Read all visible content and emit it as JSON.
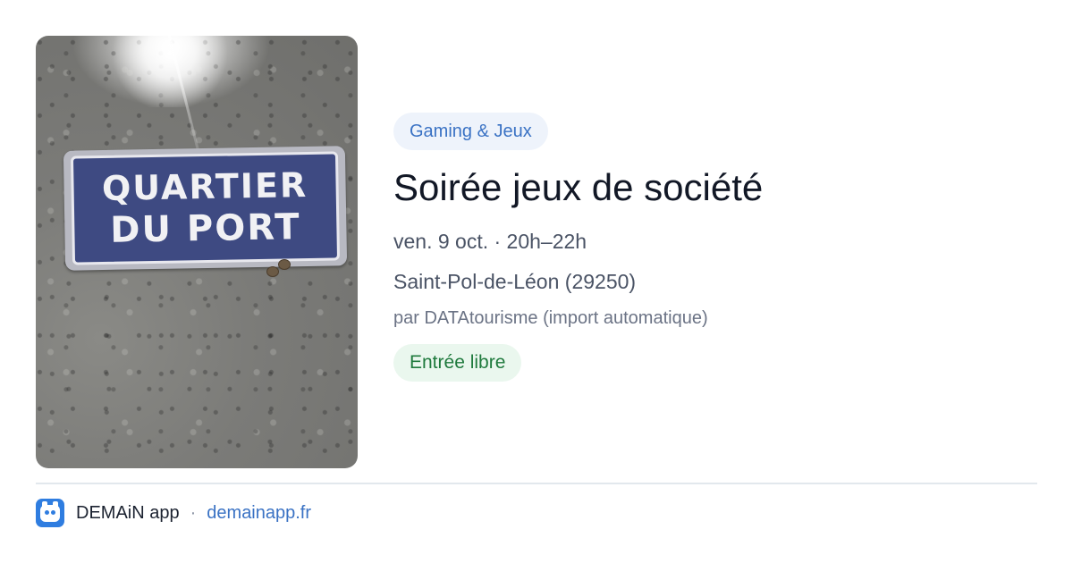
{
  "event": {
    "image": {
      "sign_line1": "QUARTIER",
      "sign_line2": "DU PORT"
    },
    "category": "Gaming & Jeux",
    "title": "Soirée jeux de société",
    "datetime": "ven. 9 oct. · 20h–22h",
    "location": "Saint-Pol-de-Léon (29250)",
    "organizer": "par DATAtourisme (import automatique)",
    "price": "Entrée libre"
  },
  "footer": {
    "app_name": "DEMAiN app",
    "separator": "·",
    "site": "demainapp.fr",
    "logo_icon": "demain-app-logo-icon"
  },
  "colors": {
    "category_chip_bg": "#eef3fb",
    "category_chip_text": "#3a72c4",
    "price_chip_bg": "#eaf7ee",
    "price_chip_text": "#1f7a3d",
    "title_text": "#121826",
    "link": "#3a72c4",
    "logo_bg": "#2f7de0"
  }
}
